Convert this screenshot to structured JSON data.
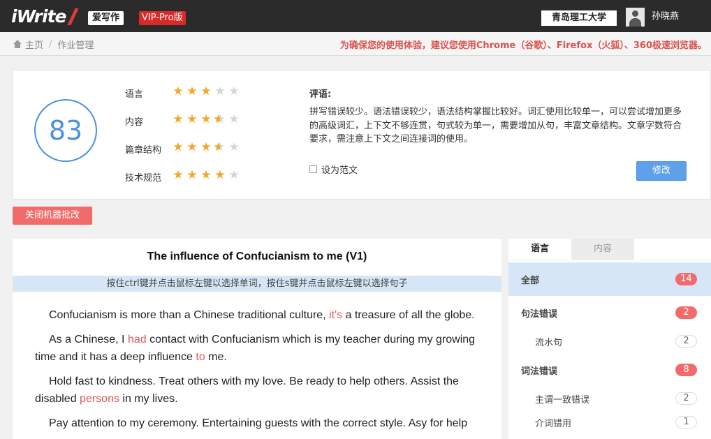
{
  "header": {
    "logo_text": "iWrite",
    "brand_cn": "爱写作",
    "vip": "VIP-Pro版",
    "school": "青岛理工大学",
    "username": "孙晓燕"
  },
  "breadcrumb": {
    "home": "主页",
    "separator": "/",
    "current": "作业管理",
    "notice": "为确保您的使用体验，建议您使用Chrome（谷歌）、Firefox（火狐）、360极速浏览器。"
  },
  "score": {
    "value": "83",
    "ratings": [
      {
        "label": "语言",
        "stars": 3,
        "max": 5
      },
      {
        "label": "内容",
        "stars": 3.5,
        "max": 5
      },
      {
        "label": "篇章结构",
        "stars": 3.5,
        "max": 5
      },
      {
        "label": "技术规范",
        "stars": 4,
        "max": 5
      }
    ],
    "comment_title": "评语:",
    "comment_text": "拼写错误较少。语法错误较少，语法结构掌握比较好。词汇使用比较单一，可以尝试增加更多的高级词汇，上下文不够连贯，句式较为单一，需要增加从句，丰富文章结构。文章字数符合要求，需注意上下文之间连接词的使用。",
    "set_model_label": "设为范文",
    "edit_button": "修改"
  },
  "close_machine_review": "关闭机器批改",
  "essay": {
    "title": "The influence of Confucianism to me   (V1)",
    "hint": "按住ctrl键并点击鼠标左键以选择单词，按住s键并点击鼠标左键以选择句子",
    "paragraphs": [
      [
        {
          "t": "Confucianism is more than a Chinese traditional culture, "
        },
        {
          "t": "it's",
          "err": true
        },
        {
          "t": " a treasure of all the globe."
        }
      ],
      [
        {
          "t": "As a Chinese, I "
        },
        {
          "t": "had",
          "err": true
        },
        {
          "t": " contact with Confucianism which is my teacher  during my growing time and it has a deep influence "
        },
        {
          "t": "to",
          "err": true
        },
        {
          "t": " me."
        }
      ],
      [
        {
          "t": "Hold fast to kindness.  Treat others with my love.  Be ready to help others.  Assist the disabled "
        },
        {
          "t": "persons",
          "err": true
        },
        {
          "t": " in my lives."
        }
      ],
      [
        {
          "t": "Pay attention to my ceremony.  Entertaining guests with the correct style.  Asy for help"
        }
      ]
    ]
  },
  "sidebar": {
    "tabs": [
      "语言",
      "内容"
    ],
    "rows": [
      {
        "label": "全部",
        "count": "14",
        "level": "top",
        "badge": "red",
        "active": true
      },
      {
        "label": "句法错误",
        "count": "2",
        "level": "top",
        "badge": "red"
      },
      {
        "label": "流水句",
        "count": "2",
        "level": "sub",
        "badge": "grey"
      },
      {
        "label": "词法错误",
        "count": "8",
        "level": "top",
        "badge": "red"
      },
      {
        "label": "主谓一致错误",
        "count": "2",
        "level": "sub",
        "badge": "grey"
      },
      {
        "label": "介词错用",
        "count": "1",
        "level": "sub",
        "badge": "grey"
      }
    ]
  }
}
